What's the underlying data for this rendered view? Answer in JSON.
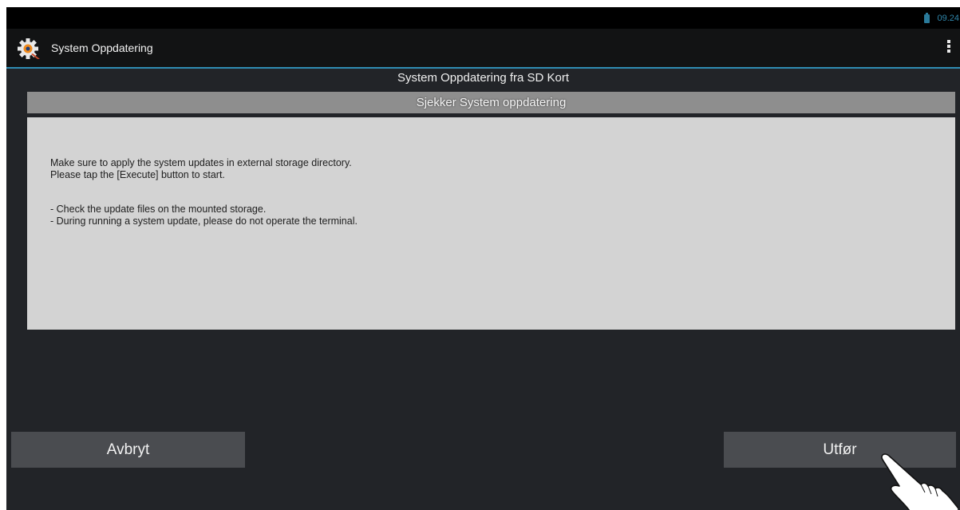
{
  "status_bar": {
    "clock": "09.24",
    "battery_icon": "battery-icon",
    "accent_color": "#2f86aa"
  },
  "action_bar": {
    "app_icon": "gear-icon",
    "title": "System Oppdatering",
    "overflow_icon": "overflow-menu-icon",
    "divider_color": "#2f8cb3"
  },
  "main": {
    "heading": "System Oppdatering fra SD Kort",
    "section_header": "Sjekker System oppdatering",
    "message_lines": [
      "Make sure to apply the system updates in external storage directory.",
      "Please tap the [Execute] button to start.",
      "- Check the update files on the mounted storage.",
      "- During running a system update, please do not operate the terminal."
    ]
  },
  "buttons": {
    "cancel_label": "Avbryt",
    "execute_label": "Utfør"
  },
  "overlay": {
    "cursor_icon": "hand-pointer-icon"
  }
}
